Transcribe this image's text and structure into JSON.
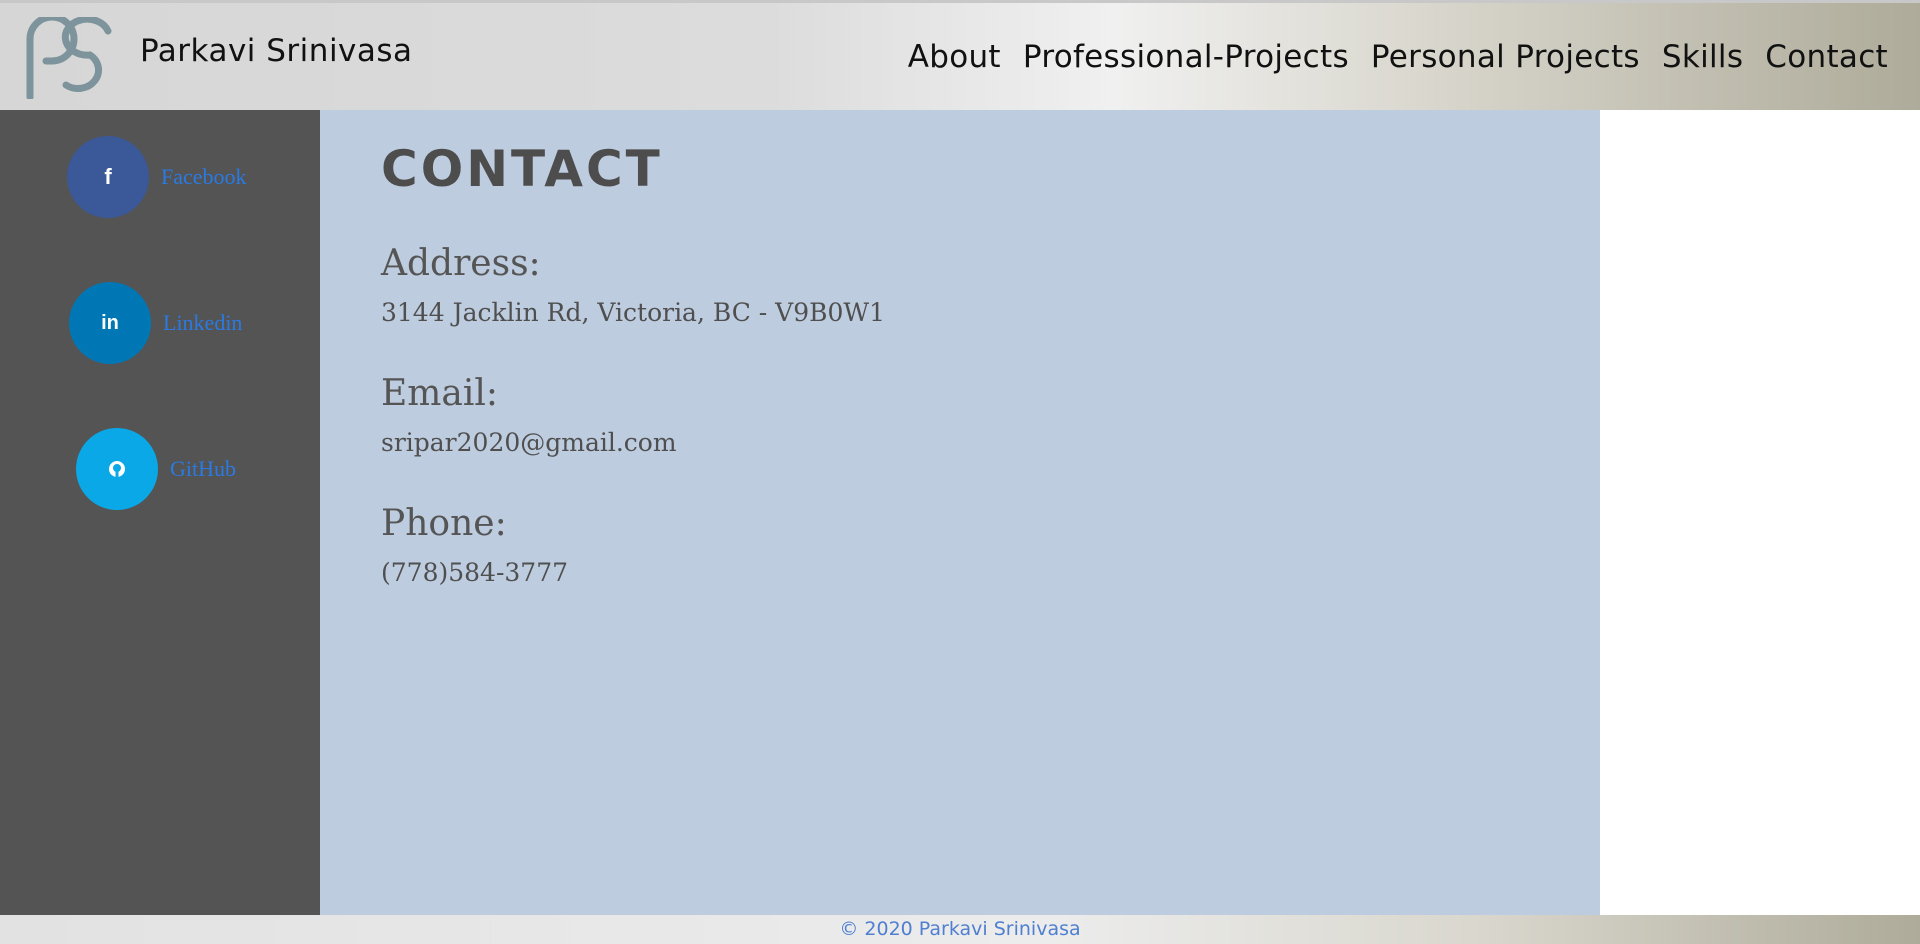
{
  "header": {
    "site_name": "Parkavi Srinivasa",
    "nav": [
      "About",
      "Professional-Projects",
      "Personal Projects",
      "Skills",
      "Contact"
    ]
  },
  "sidebar": {
    "links": [
      {
        "label": "Facebook",
        "icon": "facebook-icon",
        "glyph": "f",
        "color": "#3b5998"
      },
      {
        "label": "Linkedin",
        "icon": "linkedin-icon",
        "glyph": "in",
        "color": "#0077b5"
      },
      {
        "label": "GitHub",
        "icon": "github-icon",
        "glyph": "",
        "color": "#0aa8e6"
      }
    ]
  },
  "main": {
    "title": "CONTACT",
    "address_label": "Address:",
    "address": "3144 Jacklin Rd, Victoria, BC - V9B0W1",
    "email_label": "Email:",
    "email": "sripar2020@gmail.com",
    "phone_label": "Phone:",
    "phone": "(778)584-3777"
  },
  "footer": {
    "text": "© 2020 Parkavi Srinivasa"
  },
  "colors": {
    "sidebar_bg": "#545454",
    "main_bg": "#bdccdf",
    "link": "#2a7ae2",
    "logo": "#7d949c"
  }
}
